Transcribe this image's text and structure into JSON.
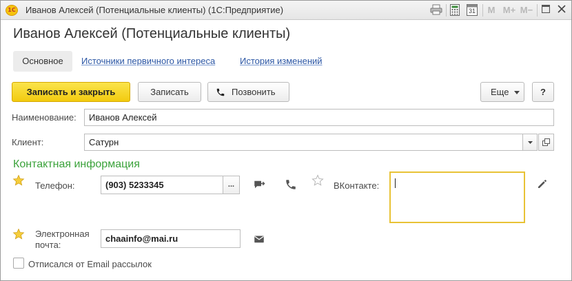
{
  "window": {
    "app_logo": "1С",
    "title": "Иванов Алексей (Потенциальные клиенты)  (1С:Предприятие)",
    "toolbar_icons": [
      "print-icon",
      "calculator-icon",
      "calendar-icon",
      "memory-icon",
      "memory-plus-icon",
      "memory-minus-icon",
      "maximize-icon",
      "close-icon"
    ],
    "calendar_day": "31",
    "m_label": "M",
    "m_plus_label": "M+",
    "m_minus_label": "M−"
  },
  "form": {
    "title": "Иванов Алексей (Потенциальные клиенты)",
    "tabs": [
      {
        "label": "Основное",
        "active": true
      },
      {
        "label": "Источники первичного интереса",
        "active": false
      },
      {
        "label": "История изменений",
        "active": false
      }
    ]
  },
  "toolbar": {
    "save_close_label": "Записать и закрыть",
    "save_label": "Записать",
    "call_label": "Позвонить",
    "more_label": "Еще",
    "help_label": "?"
  },
  "fields": {
    "name_label": "Наименование:",
    "name_value": "Иванов Алексей",
    "client_label": "Клиент:",
    "client_value": "Сатурн"
  },
  "contact": {
    "section_title": "Контактная информация",
    "phone_label": "Телефон:",
    "phone_value": "(903) 5233345",
    "phone_more": "...",
    "vk_label": "ВКонтакте:",
    "vk_value": "",
    "email_label_1": "Электронная",
    "email_label_2": "почта:",
    "email_value": "chaainfo@mai.ru"
  },
  "unsubscribe": {
    "label": "Отписался от Email рассылок",
    "checked": false
  },
  "colors": {
    "accent_yellow": "#f2cb0f",
    "section_green": "#3aa23a",
    "link_blue": "#2c57a5",
    "focus_border": "#e8c235"
  }
}
